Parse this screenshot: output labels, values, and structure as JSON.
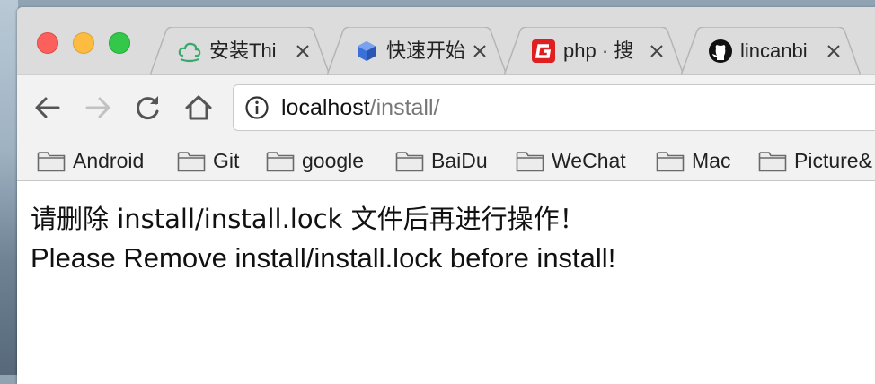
{
  "browser": {
    "tabs": [
      {
        "title": "安装Thi",
        "icon": "green-cloud-icon",
        "color": "#3aa76d"
      },
      {
        "title": "快速开始",
        "icon": "blue-cube-icon",
        "color": "#3b6fd9"
      },
      {
        "title": "php · 搜",
        "icon": "red-g-icon",
        "color": "#e02020"
      },
      {
        "title": "lincanbi",
        "icon": "github-icon",
        "color": "#111111"
      }
    ],
    "address_bar": {
      "host": "localhost",
      "path": "/install/"
    },
    "bookmarks": [
      {
        "label": "Android"
      },
      {
        "label": "Git"
      },
      {
        "label": "google"
      },
      {
        "label": "BaiDu"
      },
      {
        "label": "WeChat"
      },
      {
        "label": "Mac"
      },
      {
        "label": "Picture&"
      }
    ]
  },
  "page": {
    "message_cn": "请删除 install/install.lock 文件后再进行操作！",
    "message_en": "Please Remove install/install.lock before install!"
  },
  "colors": {
    "close": "#fc605c",
    "minimize": "#fdbc40",
    "maximize": "#34c84a"
  }
}
